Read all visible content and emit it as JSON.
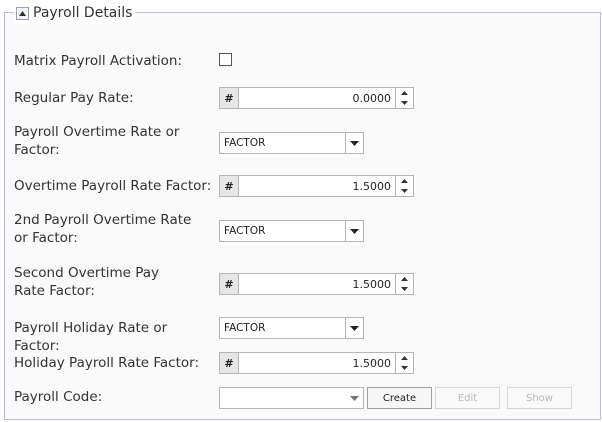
{
  "panel": {
    "title": "Payroll Details",
    "collapse_icon": "collapse-up-icon"
  },
  "fields": {
    "matrix_activation": {
      "label": "Matrix Payroll Activation:",
      "checked": false
    },
    "regular_pay_rate": {
      "label": "Regular Pay Rate:",
      "prefix": "#",
      "value": "0.0000"
    },
    "overtime_rate_or_factor": {
      "label": "Payroll Overtime Rate or Factor:",
      "selected": "FACTOR"
    },
    "overtime_rate_factor": {
      "label": "Overtime Payroll Rate Factor:",
      "prefix": "#",
      "value": "1.5000"
    },
    "second_overtime_rate_or_factor": {
      "label": "2nd Payroll Overtime Rate or Factor:",
      "selected": "FACTOR"
    },
    "second_overtime_rate_factor": {
      "label": "Second Overtime Pay Rate Factor:",
      "prefix": "#",
      "value": "1.5000"
    },
    "holiday_rate_or_factor": {
      "label": "Payroll Holiday Rate or Factor:",
      "selected": "FACTOR"
    },
    "holiday_rate_factor": {
      "label": "Holiday Payroll Rate Factor:",
      "prefix": "#",
      "value": "1.5000"
    },
    "payroll_code": {
      "label": "Payroll Code:",
      "selected": "",
      "create_label": "Create",
      "edit_label": "Edit",
      "show_label": "Show"
    }
  },
  "colors": {
    "panel_border": "#b9bfcc",
    "panel_bg": "#fafafa",
    "input_border": "#b5b5b5",
    "prefix_bg": "#e6e6e6",
    "disabled_text": "#b8b8b8"
  }
}
